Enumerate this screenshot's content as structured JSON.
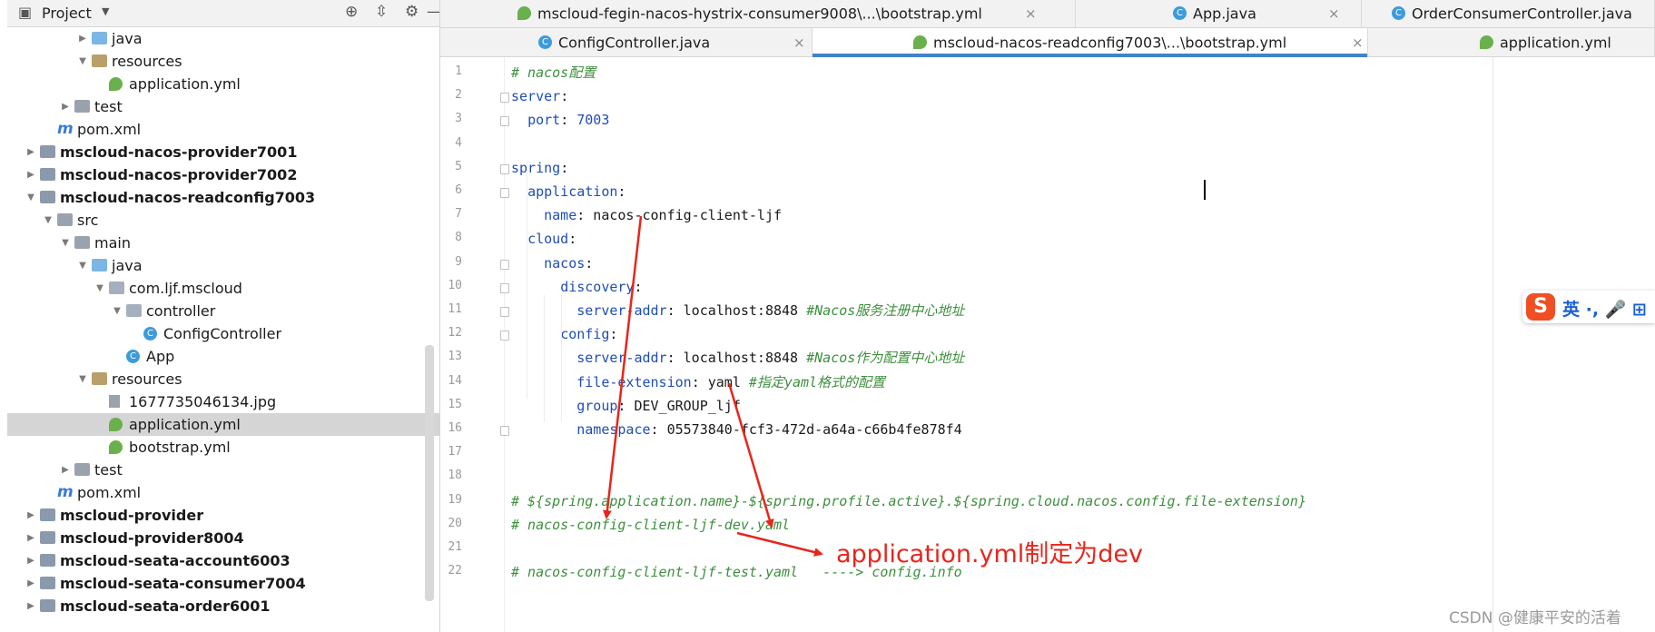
{
  "project_panel": {
    "title": "Project",
    "header_icons": [
      "locate-icon",
      "collapse-all-icon",
      "settings-gear-icon",
      "hide-icon"
    ],
    "tree": [
      {
        "label": "java",
        "icon": "folder-blue",
        "indent": 3,
        "arrow": "right",
        "bold": false
      },
      {
        "label": "resources",
        "icon": "folder-resources",
        "indent": 3,
        "arrow": "down",
        "bold": false
      },
      {
        "label": "application.yml",
        "icon": "yml-file",
        "indent": 4,
        "arrow": "",
        "bold": false
      },
      {
        "label": "test",
        "icon": "folder-gray",
        "indent": 2,
        "arrow": "right",
        "bold": false
      },
      {
        "label": "pom.xml",
        "icon": "maven",
        "indent": 1,
        "arrow": "",
        "bold": false
      },
      {
        "label": "mscloud-nacos-provider7001",
        "icon": "module",
        "indent": 0,
        "arrow": "right",
        "bold": true
      },
      {
        "label": "mscloud-nacos-provider7002",
        "icon": "module",
        "indent": 0,
        "arrow": "right",
        "bold": true
      },
      {
        "label": "mscloud-nacos-readconfig7003",
        "icon": "module",
        "indent": 0,
        "arrow": "down",
        "bold": true
      },
      {
        "label": "src",
        "icon": "folder-gray",
        "indent": 1,
        "arrow": "down",
        "bold": false
      },
      {
        "label": "main",
        "icon": "folder-gray",
        "indent": 2,
        "arrow": "down",
        "bold": false
      },
      {
        "label": "java",
        "icon": "folder-blue",
        "indent": 3,
        "arrow": "down",
        "bold": false
      },
      {
        "label": "com.ljf.mscloud",
        "icon": "package",
        "indent": 4,
        "arrow": "down",
        "bold": false
      },
      {
        "label": "controller",
        "icon": "package",
        "indent": 5,
        "arrow": "down",
        "bold": false
      },
      {
        "label": "ConfigController",
        "icon": "class",
        "indent": 6,
        "arrow": "",
        "bold": false
      },
      {
        "label": "App",
        "icon": "class-app",
        "indent": 5,
        "arrow": "",
        "bold": false
      },
      {
        "label": "resources",
        "icon": "folder-resources",
        "indent": 3,
        "arrow": "down",
        "bold": false
      },
      {
        "label": "1677735046134.jpg",
        "icon": "image",
        "indent": 4,
        "arrow": "",
        "bold": false
      },
      {
        "label": "application.yml",
        "icon": "yml-file",
        "indent": 4,
        "arrow": "",
        "bold": false,
        "selected": true
      },
      {
        "label": "bootstrap.yml",
        "icon": "yml-file",
        "indent": 4,
        "arrow": "",
        "bold": false
      },
      {
        "label": "test",
        "icon": "folder-gray",
        "indent": 2,
        "arrow": "right",
        "bold": false
      },
      {
        "label": "pom.xml",
        "icon": "maven",
        "indent": 1,
        "arrow": "",
        "bold": false
      },
      {
        "label": "mscloud-provider",
        "icon": "module",
        "indent": 0,
        "arrow": "right",
        "bold": true
      },
      {
        "label": "mscloud-provider8004",
        "icon": "module",
        "indent": 0,
        "arrow": "right",
        "bold": true
      },
      {
        "label": "mscloud-seata-account6003",
        "icon": "module",
        "indent": 0,
        "arrow": "right",
        "bold": true
      },
      {
        "label": "mscloud-seata-consumer7004",
        "icon": "module",
        "indent": 0,
        "arrow": "right",
        "bold": true
      },
      {
        "label": "mscloud-seata-order6001",
        "icon": "module",
        "indent": 0,
        "arrow": "right",
        "bold": true
      }
    ]
  },
  "tabs_row1": [
    {
      "label": "mscloud-fegin-nacos-hystrix-consumer9008\\...\\bootstrap.yml",
      "icon": "yml"
    },
    {
      "label": "App.java",
      "icon": "class"
    },
    {
      "label": "OrderConsumerController.java",
      "icon": "class"
    }
  ],
  "tabs_row2": [
    {
      "label": "ConfigController.java",
      "icon": "class",
      "active": false
    },
    {
      "label": "mscloud-nacos-readconfig7003\\...\\bootstrap.yml",
      "icon": "yml",
      "active": true
    },
    {
      "label": "application.yml",
      "icon": "yml",
      "active": false
    }
  ],
  "tab_close": "×",
  "editor": {
    "current_line": 6,
    "lines": [
      {
        "n": 1,
        "parts": [
          [
            "c",
            "# nacos配置"
          ]
        ]
      },
      {
        "n": 2,
        "parts": [
          [
            "k",
            "server"
          ],
          [
            "t",
            ":"
          ]
        ]
      },
      {
        "n": 3,
        "parts": [
          [
            "t",
            "  "
          ],
          [
            "k",
            "port"
          ],
          [
            "t",
            ": "
          ],
          [
            "v",
            "7003"
          ]
        ]
      },
      {
        "n": 4,
        "parts": []
      },
      {
        "n": 5,
        "parts": [
          [
            "k",
            "spring"
          ],
          [
            "t",
            ":"
          ]
        ]
      },
      {
        "n": 6,
        "parts": [
          [
            "t",
            "  "
          ],
          [
            "k",
            "application"
          ],
          [
            "t",
            ":"
          ]
        ]
      },
      {
        "n": 7,
        "parts": [
          [
            "t",
            "    "
          ],
          [
            "k",
            "name"
          ],
          [
            "t",
            ": nacos-config-client-ljf"
          ]
        ]
      },
      {
        "n": 8,
        "parts": [
          [
            "t",
            "  "
          ],
          [
            "k",
            "cloud"
          ],
          [
            "t",
            ":"
          ]
        ]
      },
      {
        "n": 9,
        "parts": [
          [
            "t",
            "    "
          ],
          [
            "k",
            "nacos"
          ],
          [
            "t",
            ":"
          ]
        ]
      },
      {
        "n": 10,
        "parts": [
          [
            "t",
            "      "
          ],
          [
            "k",
            "discovery"
          ],
          [
            "t",
            ":"
          ]
        ]
      },
      {
        "n": 11,
        "parts": [
          [
            "t",
            "        "
          ],
          [
            "k",
            "server-addr"
          ],
          [
            "t",
            ": localhost:8848 "
          ],
          [
            "c",
            "#Nacos服务注册中心地址"
          ]
        ]
      },
      {
        "n": 12,
        "parts": [
          [
            "t",
            "      "
          ],
          [
            "k",
            "config"
          ],
          [
            "t",
            ":"
          ]
        ]
      },
      {
        "n": 13,
        "parts": [
          [
            "t",
            "        "
          ],
          [
            "k",
            "server-addr"
          ],
          [
            "t",
            ": localhost:8848 "
          ],
          [
            "c",
            "#Nacos作为配置中心地址"
          ]
        ]
      },
      {
        "n": 14,
        "parts": [
          [
            "t",
            "        "
          ],
          [
            "k",
            "file-extension"
          ],
          [
            "t",
            ": yaml "
          ],
          [
            "c",
            "#指定yaml格式的配置"
          ]
        ]
      },
      {
        "n": 15,
        "parts": [
          [
            "t",
            "        "
          ],
          [
            "k",
            "group"
          ],
          [
            "t",
            ": DEV_GROUP_ljf"
          ]
        ]
      },
      {
        "n": 16,
        "parts": [
          [
            "t",
            "        "
          ],
          [
            "k",
            "namespace"
          ],
          [
            "t",
            ": 05573840-fcf3-472d-a64a-c66b4fe878f4"
          ]
        ]
      },
      {
        "n": 17,
        "parts": []
      },
      {
        "n": 18,
        "parts": []
      },
      {
        "n": 19,
        "parts": [
          [
            "c",
            "# ${spring.application.name}-${spring.profile.active}.${spring.cloud.nacos.config.file-extension}"
          ]
        ]
      },
      {
        "n": 20,
        "parts": [
          [
            "c",
            "# nacos-config-client-ljf-dev.yaml"
          ]
        ]
      },
      {
        "n": 21,
        "parts": []
      },
      {
        "n": 22,
        "parts": [
          [
            "c",
            "# nacos-config-client-ljf-test.yaml   ----> config.info"
          ]
        ]
      }
    ]
  },
  "annotation": "application.yml制定为dev",
  "ime_toolbar": {
    "logo": "S",
    "text": "英 ·, 🎤 ⊞"
  },
  "watermark": "CSDN @健康平安的活着",
  "colors": {
    "arrow": "#e8251c",
    "keyword": "#1f4db6",
    "comment": "#3d8f3d",
    "accent": "#4083c9"
  }
}
